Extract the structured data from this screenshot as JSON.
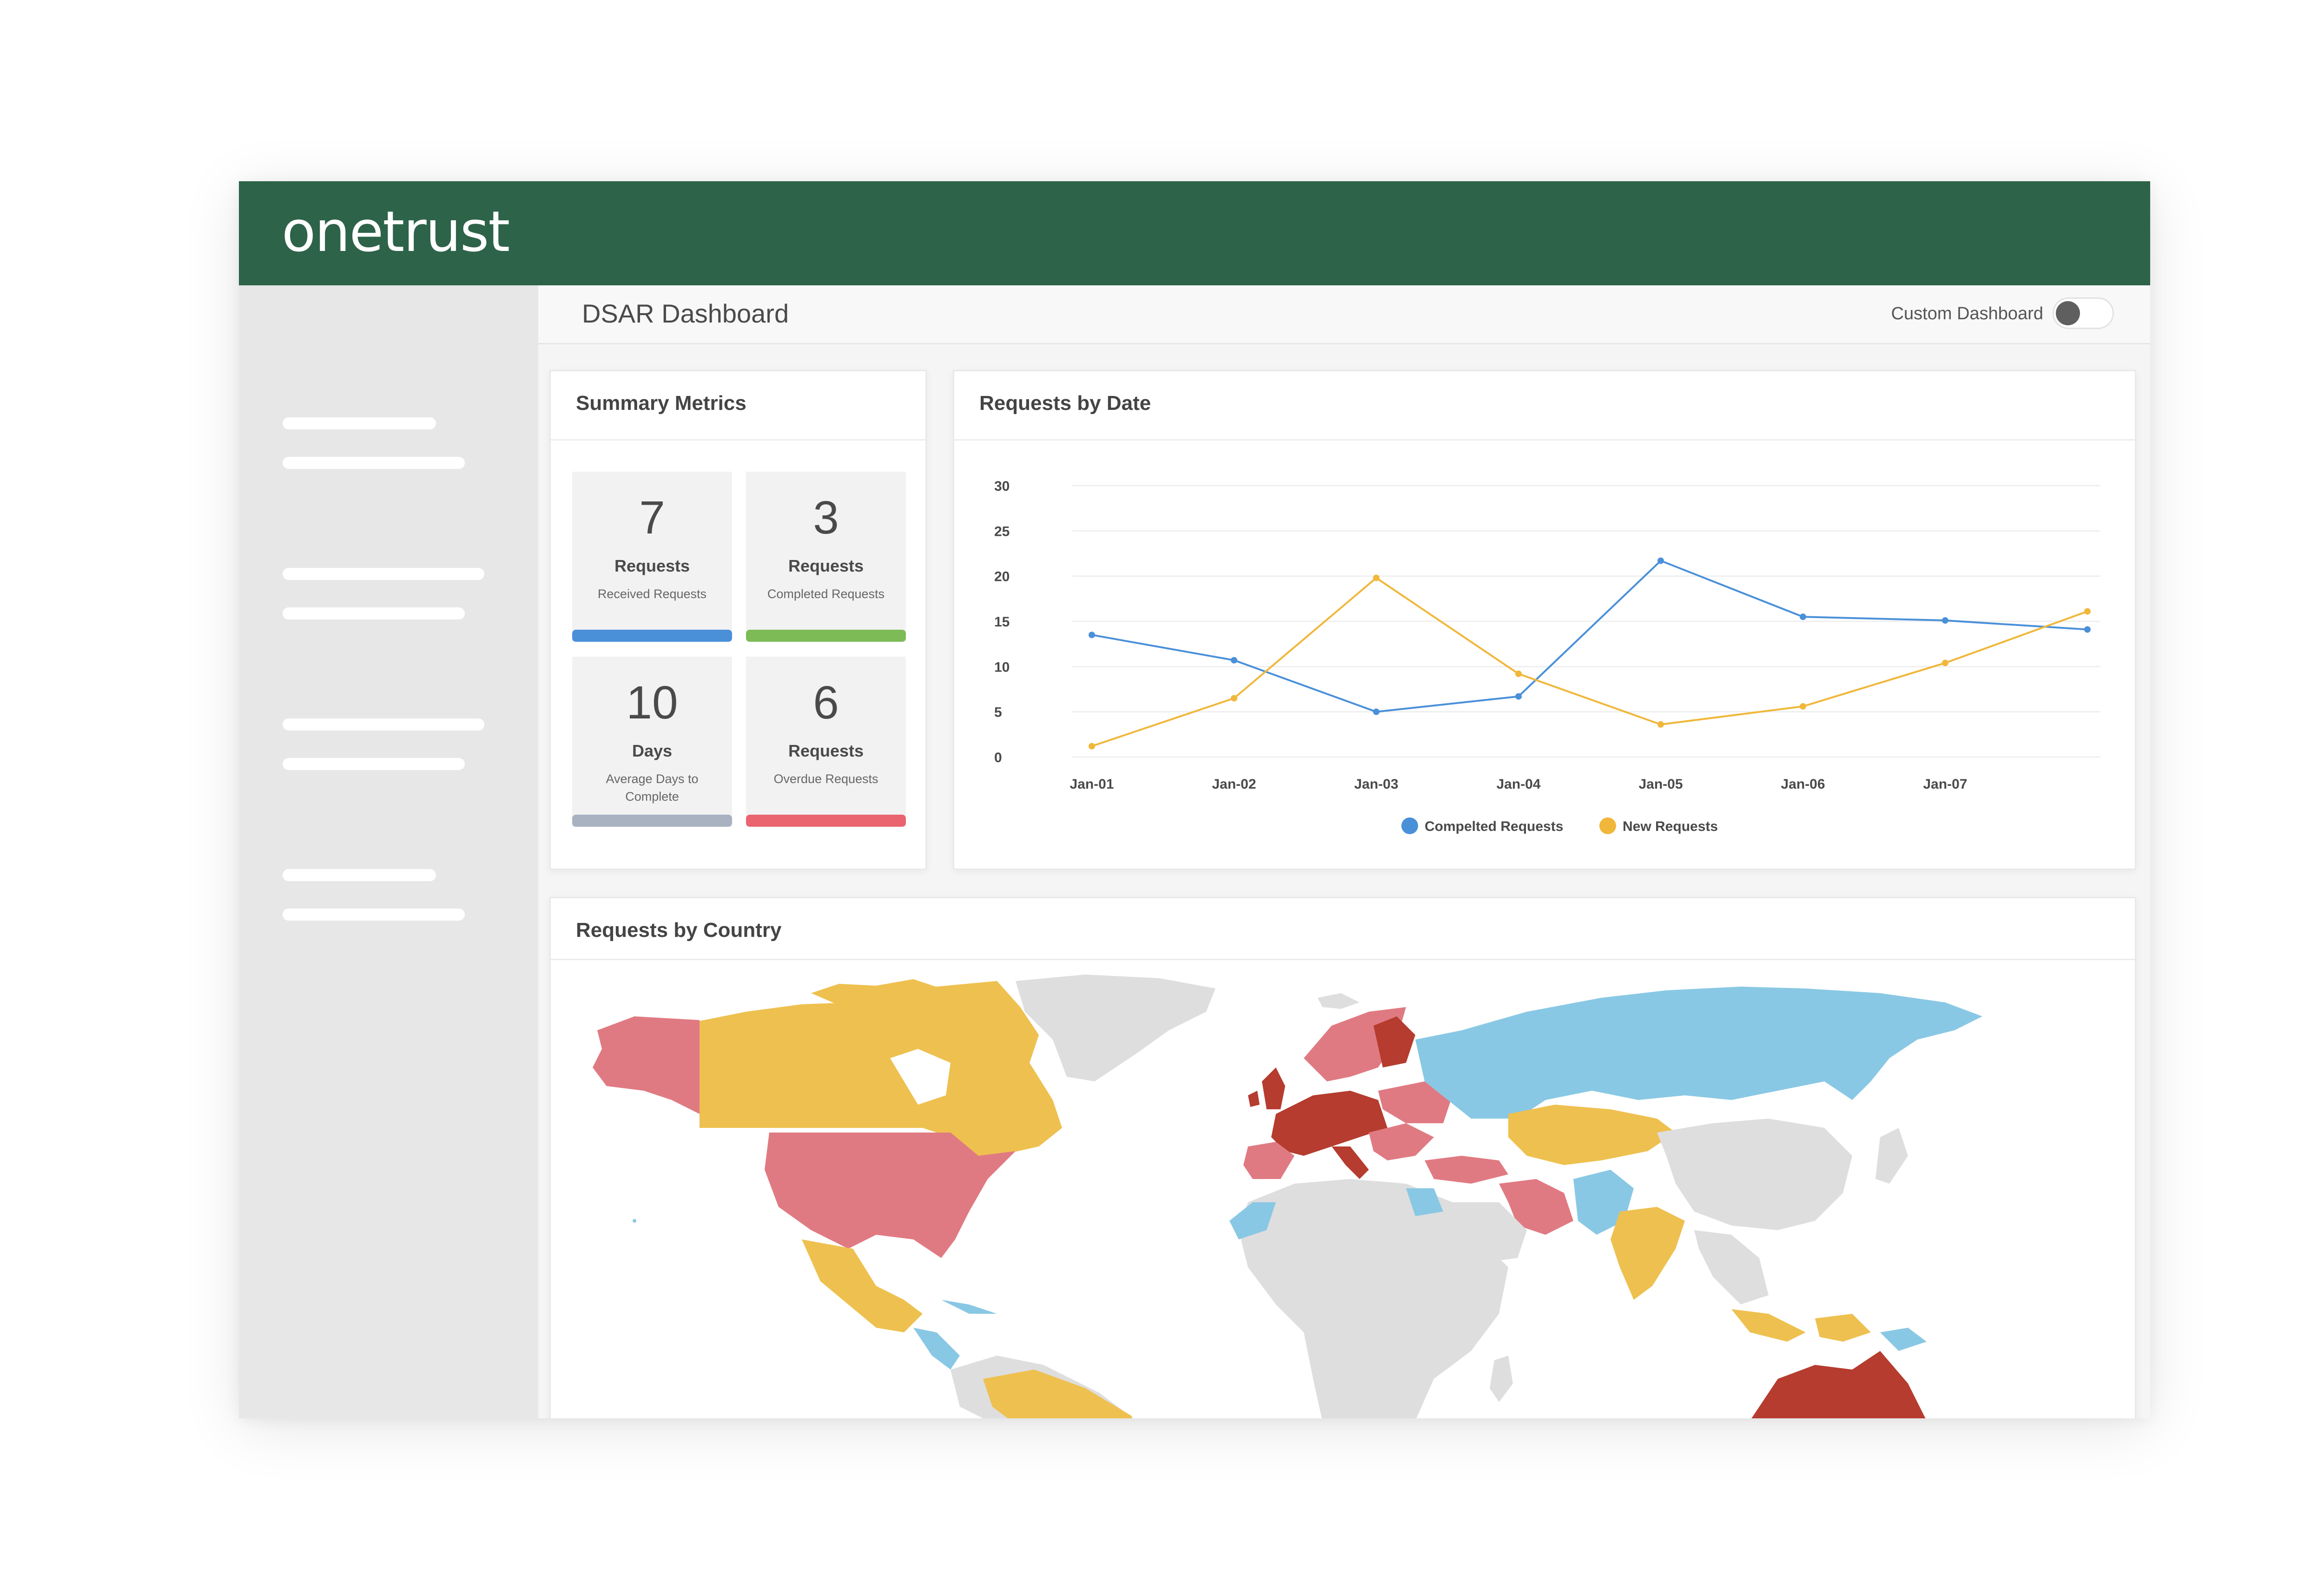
{
  "app": {
    "logo": "onetrust"
  },
  "header": {
    "title": "DSAR Dashboard",
    "custom_dashboard_label": "Custom Dashboard",
    "custom_dashboard_on": false
  },
  "summary": {
    "title": "Summary Metrics",
    "metrics": [
      {
        "value": "7",
        "unit": "Requests",
        "label": "Received Requests",
        "color": "#4a90d9"
      },
      {
        "value": "3",
        "unit": "Requests",
        "label": "Completed Requests",
        "color": "#7dbb57"
      },
      {
        "value": "10",
        "unit": "Days",
        "label": "Average Days to Complete",
        "color": "#a9b2c1"
      },
      {
        "value": "6",
        "unit": "Requests",
        "label": "Overdue Requests",
        "color": "#e9646f"
      }
    ]
  },
  "requests_by_date": {
    "title": "Requests by Date"
  },
  "chart_data": {
    "type": "line",
    "title": "Requests by Date",
    "categories": [
      "Jan-01",
      "Jan-02",
      "Jan-03",
      "Jan-04",
      "Jan-05",
      "Jan-06",
      "Jan-07",
      ""
    ],
    "y_ticks": [
      0,
      5,
      10,
      15,
      20,
      25,
      30
    ],
    "ylim": [
      0,
      30
    ],
    "grid": true,
    "legend_position": "bottom",
    "series": [
      {
        "name": "Compelted Requests",
        "color": "#4a90d9",
        "values": [
          13.5,
          10.7,
          5,
          6.7,
          21.7,
          15.5,
          15.1,
          14.1
        ]
      },
      {
        "name": "New Requests",
        "color": "#f0b73a",
        "values": [
          1.2,
          6.5,
          19.8,
          9.2,
          3.6,
          5.6,
          10.4,
          16.1
        ]
      }
    ]
  },
  "requests_by_country": {
    "title": "Requests by Country",
    "colors": {
      "none": "#dedede",
      "low": "#89c8e4",
      "medium": "#eec04f",
      "high": "#e07a82",
      "highest": "#b53c2e"
    }
  }
}
